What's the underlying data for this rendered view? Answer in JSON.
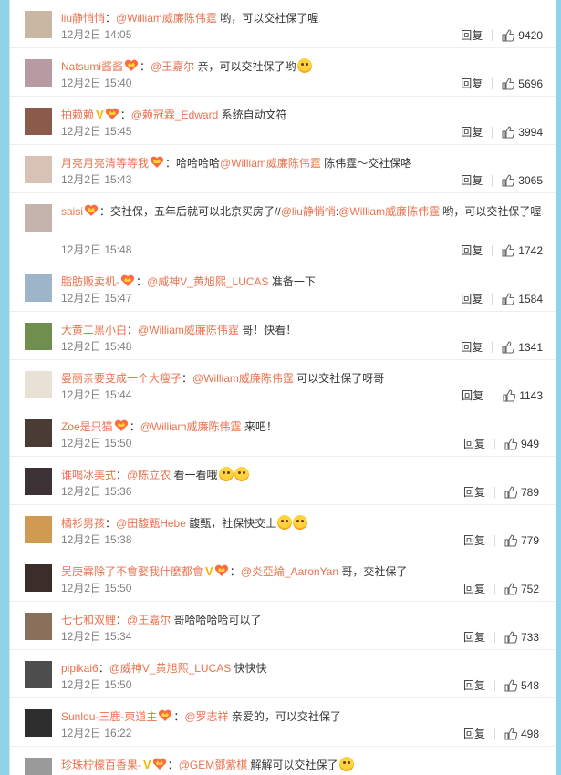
{
  "reply_label": "回复",
  "comments": [
    {
      "user": "liu静悄悄",
      "badges": [],
      "text_parts": [
        {
          "t": "mention",
          "v": "@William威廉陈伟霆"
        },
        {
          "t": "text",
          "v": " 哟，可以交社保了喔"
        }
      ],
      "time": "12月2日 14:05",
      "likes": "9420",
      "emoji": 0
    },
    {
      "user": "Natsumi酱酱",
      "badges": [
        "member"
      ],
      "text_parts": [
        {
          "t": "mention",
          "v": "@王嘉尔"
        },
        {
          "t": "text",
          "v": " 亲，可以交社保了哟"
        }
      ],
      "time": "12月2日 15:40",
      "likes": "5696",
      "emoji": 1
    },
    {
      "user": "拍赖赖",
      "badges": [
        "v",
        "member"
      ],
      "text_parts": [
        {
          "t": "mention",
          "v": "@赖冠霖_Edward"
        },
        {
          "t": "text",
          "v": " 系统自动文符"
        }
      ],
      "time": "12月2日 15:45",
      "likes": "3994",
      "emoji": 0
    },
    {
      "user": "月亮月亮清等等我",
      "badges": [
        "member"
      ],
      "text_parts": [
        {
          "t": "text",
          "v": "哈哈哈哈"
        },
        {
          "t": "mention",
          "v": "@William威廉陈伟霆"
        },
        {
          "t": "text",
          "v": " 陈伟霆～交社保咯"
        }
      ],
      "time": "12月2日 15:43",
      "likes": "3065",
      "emoji": 0
    },
    {
      "user": "saisi",
      "badges": [
        "member"
      ],
      "text_parts": [
        {
          "t": "text",
          "v": "交社保，五年后就可以北京买房了//"
        },
        {
          "t": "mention",
          "v": "@liu静悄悄"
        },
        {
          "t": "text",
          "v": ":"
        },
        {
          "t": "mention",
          "v": "@William威廉陈伟霆"
        },
        {
          "t": "text",
          "v": " 哟，可以交社保了喔"
        }
      ],
      "time": "12月2日 15:48",
      "likes": "1742",
      "emoji": 0,
      "tall": true
    },
    {
      "user": "脂肪贩卖机-",
      "badges": [
        "member"
      ],
      "text_parts": [
        {
          "t": "mention",
          "v": "@威神V_黄旭熙_LUCAS"
        },
        {
          "t": "text",
          "v": " 准备一下"
        }
      ],
      "time": "12月2日 15:47",
      "likes": "1584",
      "emoji": 0
    },
    {
      "user": "大黄二黑小白",
      "badges": [],
      "text_parts": [
        {
          "t": "mention",
          "v": "@William威廉陈伟霆"
        },
        {
          "t": "text",
          "v": " 哥！快看！"
        }
      ],
      "time": "12月2日 15:48",
      "likes": "1341",
      "emoji": 0
    },
    {
      "user": "曼丽亲要变成一个大瘦子",
      "badges": [],
      "text_parts": [
        {
          "t": "mention",
          "v": "@William威廉陈伟霆"
        },
        {
          "t": "text",
          "v": " 可以交社保了呀哥"
        }
      ],
      "time": "12月2日 15:44",
      "likes": "1143",
      "emoji": 0
    },
    {
      "user": "Zoe是只猫",
      "badges": [
        "member"
      ],
      "text_parts": [
        {
          "t": "mention",
          "v": "@William威廉陈伟霆"
        },
        {
          "t": "text",
          "v": " 来吧！"
        }
      ],
      "time": "12月2日 15:50",
      "likes": "949",
      "emoji": 0
    },
    {
      "user": "谁喝冰美式",
      "badges": [],
      "text_parts": [
        {
          "t": "mention",
          "v": "@陈立农"
        },
        {
          "t": "text",
          "v": " 看一看哦"
        }
      ],
      "time": "12月2日 15:36",
      "likes": "789",
      "emoji": 2
    },
    {
      "user": "橘衫男孩",
      "badges": [],
      "text_parts": [
        {
          "t": "mention",
          "v": "@田馥甄Hebe"
        },
        {
          "t": "text",
          "v": " 馥甄，社保快交上"
        }
      ],
      "time": "12月2日 15:38",
      "likes": "779",
      "emoji": 2
    },
    {
      "user": "吴庚霖除了不會娶我什麼都會",
      "badges": [
        "v",
        "member"
      ],
      "text_parts": [
        {
          "t": "mention",
          "v": "@炎亞綸_AaronYan"
        },
        {
          "t": "text",
          "v": " 哥，交社保了"
        }
      ],
      "time": "12月2日 15:50",
      "likes": "752",
      "emoji": 0
    },
    {
      "user": "七七和双鲤",
      "badges": [],
      "text_parts": [
        {
          "t": "mention",
          "v": "@王嘉尔"
        },
        {
          "t": "text",
          "v": " 哥哈哈哈哈可以了"
        }
      ],
      "time": "12月2日 15:34",
      "likes": "733",
      "emoji": 0
    },
    {
      "user": "pipikai6",
      "badges": [],
      "text_parts": [
        {
          "t": "mention",
          "v": "@威神V_黄旭熙_LUCAS"
        },
        {
          "t": "text",
          "v": " 快快快"
        }
      ],
      "time": "12月2日 15:50",
      "likes": "548",
      "emoji": 0
    },
    {
      "user": "Sunlou-三鹿-東道主",
      "badges": [
        "member"
      ],
      "text_parts": [
        {
          "t": "mention",
          "v": "@罗志祥"
        },
        {
          "t": "text",
          "v": " 亲爱的，可以交社保了"
        }
      ],
      "time": "12月2日 16:22",
      "likes": "498",
      "emoji": 0
    },
    {
      "user": "珍珠柠檬百香果-",
      "badges": [
        "v",
        "member"
      ],
      "text_parts": [
        {
          "t": "mention",
          "v": "@GEM鄧紫棋"
        },
        {
          "t": "text",
          "v": " 解解可以交社保了"
        }
      ],
      "time": "",
      "likes": "",
      "emoji": 1
    }
  ],
  "avatar_colors": [
    "#c9b7a3",
    "#b89aa2",
    "#8a5a4a",
    "#d7c2b5",
    "#c5b3ad",
    "#9cb6c8",
    "#6e8f4e",
    "#e7e1d6",
    "#4a3b35",
    "#3d3336",
    "#d09a52",
    "#3b2e2a",
    "#8a6f5b",
    "#4d4d4d",
    "#2e2e2e",
    "#9a9a9a"
  ]
}
